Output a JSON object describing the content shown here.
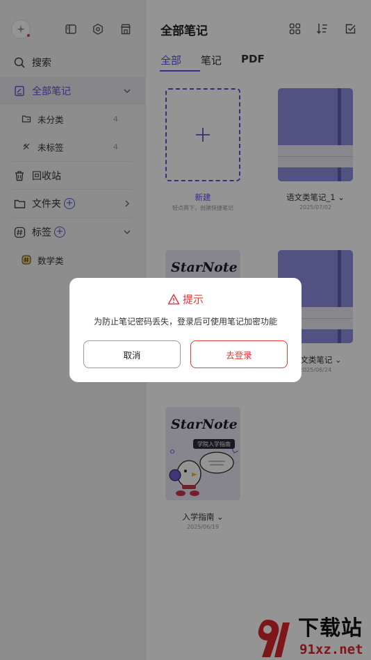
{
  "sidebar": {
    "search_label": "搜索",
    "all_notes_label": "全部笔记",
    "uncategorized_label": "未分类",
    "uncategorized_count": "4",
    "untagged_label": "未标签",
    "untagged_count": "4",
    "trash_label": "回收站",
    "folders_label": "文件夹",
    "tags_label": "标签",
    "tag_items": [
      {
        "label": "数学类"
      }
    ]
  },
  "main": {
    "title": "全部笔记",
    "tabs": [
      {
        "label": "全部"
      },
      {
        "label": "笔记"
      },
      {
        "label": "PDF"
      }
    ],
    "new_card": {
      "name": "新建",
      "hint": "轻点两下，创建快捷笔记"
    },
    "notes": [
      {
        "name": "语文类笔记_1",
        "date": "2025/07/02"
      },
      {
        "name": "文类笔记",
        "date": "2025/06/24"
      },
      {
        "name": "入学指南",
        "date": "2025/06/19"
      }
    ],
    "guide_book_logo": "StarNote",
    "guide_book_sub": "学院入学指南"
  },
  "dialog": {
    "title": "提示",
    "message": "为防止笔记密码丢失，登录后可使用笔记加密功能",
    "cancel_label": "取消",
    "login_label": "去登录"
  },
  "watermark": {
    "brand": "下载站",
    "domain": "91xz.net"
  },
  "colors": {
    "accent": "#5b52d6",
    "danger": "#e53935"
  }
}
